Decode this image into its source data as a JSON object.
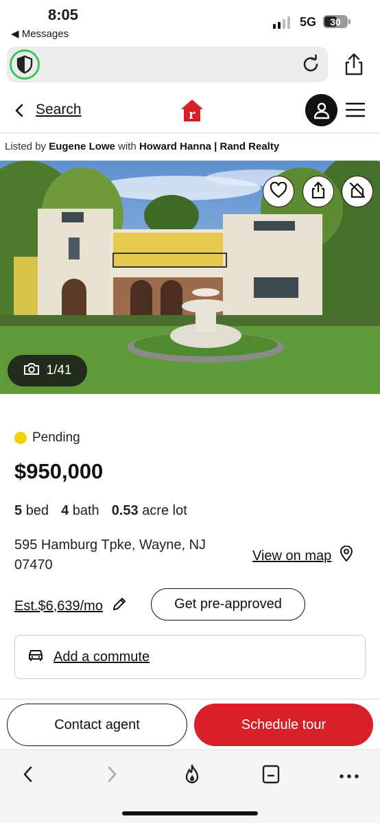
{
  "status_bar": {
    "time": "8:05",
    "back_app": "◀ Messages",
    "network": "5G",
    "battery": "30"
  },
  "header": {
    "search_label": "Search",
    "brand_color": "#d61f26"
  },
  "listing": {
    "listed_by_prefix": "Listed by",
    "agent": "Eugene Lowe",
    "with_text": "with",
    "brokerage": "Howard Hanna | Rand Realty",
    "photo_counter": "1/41",
    "status": "Pending",
    "status_color": "#f5cf00",
    "price": "$950,000",
    "beds_value": "5",
    "beds_label": "bed",
    "baths_value": "4",
    "baths_label": "bath",
    "lot_value": "0.53",
    "lot_label": "acre lot",
    "address_line1": "595 Hamburg Tpke, Wayne, NJ",
    "address_line2": "07470",
    "view_map_label": "View on map",
    "est_payment": "Est.$6,639/mo",
    "preapproved_label": "Get pre-approved",
    "commute_label": "Add a commute"
  },
  "cta": {
    "contact_label": "Contact agent",
    "tour_label": "Schedule tour"
  },
  "icons": {
    "browser": [
      "shield-icon",
      "reload-icon",
      "share-icon"
    ],
    "photo_actions": [
      "heart-icon",
      "share-icon",
      "hide-home-icon"
    ],
    "toolbar": [
      "back-icon",
      "forward-icon",
      "flame-icon",
      "tabs-icon",
      "more-icon"
    ]
  }
}
